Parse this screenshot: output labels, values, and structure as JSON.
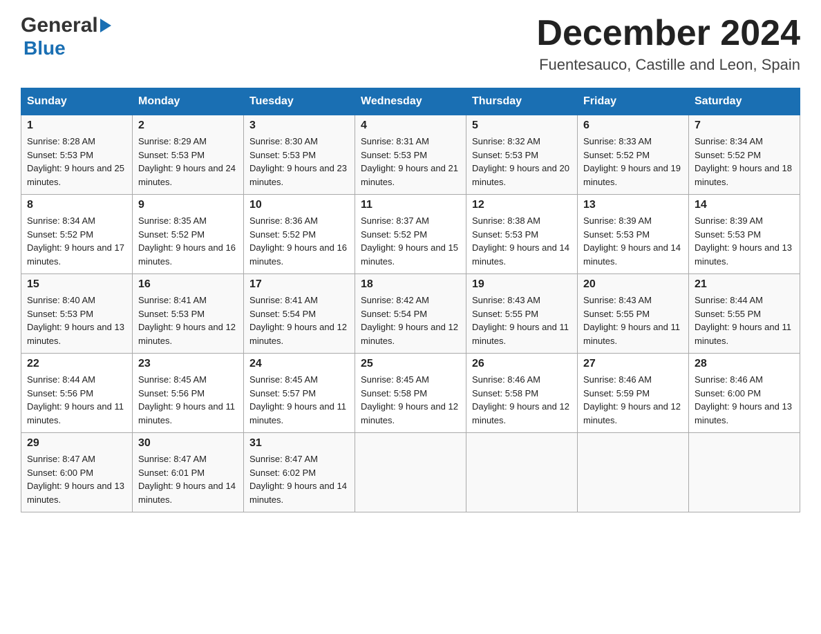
{
  "logo": {
    "general": "General",
    "blue": "Blue"
  },
  "title": {
    "month": "December 2024",
    "location": "Fuentesauco, Castille and Leon, Spain"
  },
  "headers": [
    "Sunday",
    "Monday",
    "Tuesday",
    "Wednesday",
    "Thursday",
    "Friday",
    "Saturday"
  ],
  "weeks": [
    [
      {
        "day": "1",
        "sunrise": "Sunrise: 8:28 AM",
        "sunset": "Sunset: 5:53 PM",
        "daylight": "Daylight: 9 hours and 25 minutes."
      },
      {
        "day": "2",
        "sunrise": "Sunrise: 8:29 AM",
        "sunset": "Sunset: 5:53 PM",
        "daylight": "Daylight: 9 hours and 24 minutes."
      },
      {
        "day": "3",
        "sunrise": "Sunrise: 8:30 AM",
        "sunset": "Sunset: 5:53 PM",
        "daylight": "Daylight: 9 hours and 23 minutes."
      },
      {
        "day": "4",
        "sunrise": "Sunrise: 8:31 AM",
        "sunset": "Sunset: 5:53 PM",
        "daylight": "Daylight: 9 hours and 21 minutes."
      },
      {
        "day": "5",
        "sunrise": "Sunrise: 8:32 AM",
        "sunset": "Sunset: 5:53 PM",
        "daylight": "Daylight: 9 hours and 20 minutes."
      },
      {
        "day": "6",
        "sunrise": "Sunrise: 8:33 AM",
        "sunset": "Sunset: 5:52 PM",
        "daylight": "Daylight: 9 hours and 19 minutes."
      },
      {
        "day": "7",
        "sunrise": "Sunrise: 8:34 AM",
        "sunset": "Sunset: 5:52 PM",
        "daylight": "Daylight: 9 hours and 18 minutes."
      }
    ],
    [
      {
        "day": "8",
        "sunrise": "Sunrise: 8:34 AM",
        "sunset": "Sunset: 5:52 PM",
        "daylight": "Daylight: 9 hours and 17 minutes."
      },
      {
        "day": "9",
        "sunrise": "Sunrise: 8:35 AM",
        "sunset": "Sunset: 5:52 PM",
        "daylight": "Daylight: 9 hours and 16 minutes."
      },
      {
        "day": "10",
        "sunrise": "Sunrise: 8:36 AM",
        "sunset": "Sunset: 5:52 PM",
        "daylight": "Daylight: 9 hours and 16 minutes."
      },
      {
        "day": "11",
        "sunrise": "Sunrise: 8:37 AM",
        "sunset": "Sunset: 5:52 PM",
        "daylight": "Daylight: 9 hours and 15 minutes."
      },
      {
        "day": "12",
        "sunrise": "Sunrise: 8:38 AM",
        "sunset": "Sunset: 5:53 PM",
        "daylight": "Daylight: 9 hours and 14 minutes."
      },
      {
        "day": "13",
        "sunrise": "Sunrise: 8:39 AM",
        "sunset": "Sunset: 5:53 PM",
        "daylight": "Daylight: 9 hours and 14 minutes."
      },
      {
        "day": "14",
        "sunrise": "Sunrise: 8:39 AM",
        "sunset": "Sunset: 5:53 PM",
        "daylight": "Daylight: 9 hours and 13 minutes."
      }
    ],
    [
      {
        "day": "15",
        "sunrise": "Sunrise: 8:40 AM",
        "sunset": "Sunset: 5:53 PM",
        "daylight": "Daylight: 9 hours and 13 minutes."
      },
      {
        "day": "16",
        "sunrise": "Sunrise: 8:41 AM",
        "sunset": "Sunset: 5:53 PM",
        "daylight": "Daylight: 9 hours and 12 minutes."
      },
      {
        "day": "17",
        "sunrise": "Sunrise: 8:41 AM",
        "sunset": "Sunset: 5:54 PM",
        "daylight": "Daylight: 9 hours and 12 minutes."
      },
      {
        "day": "18",
        "sunrise": "Sunrise: 8:42 AM",
        "sunset": "Sunset: 5:54 PM",
        "daylight": "Daylight: 9 hours and 12 minutes."
      },
      {
        "day": "19",
        "sunrise": "Sunrise: 8:43 AM",
        "sunset": "Sunset: 5:55 PM",
        "daylight": "Daylight: 9 hours and 11 minutes."
      },
      {
        "day": "20",
        "sunrise": "Sunrise: 8:43 AM",
        "sunset": "Sunset: 5:55 PM",
        "daylight": "Daylight: 9 hours and 11 minutes."
      },
      {
        "day": "21",
        "sunrise": "Sunrise: 8:44 AM",
        "sunset": "Sunset: 5:55 PM",
        "daylight": "Daylight: 9 hours and 11 minutes."
      }
    ],
    [
      {
        "day": "22",
        "sunrise": "Sunrise: 8:44 AM",
        "sunset": "Sunset: 5:56 PM",
        "daylight": "Daylight: 9 hours and 11 minutes."
      },
      {
        "day": "23",
        "sunrise": "Sunrise: 8:45 AM",
        "sunset": "Sunset: 5:56 PM",
        "daylight": "Daylight: 9 hours and 11 minutes."
      },
      {
        "day": "24",
        "sunrise": "Sunrise: 8:45 AM",
        "sunset": "Sunset: 5:57 PM",
        "daylight": "Daylight: 9 hours and 11 minutes."
      },
      {
        "day": "25",
        "sunrise": "Sunrise: 8:45 AM",
        "sunset": "Sunset: 5:58 PM",
        "daylight": "Daylight: 9 hours and 12 minutes."
      },
      {
        "day": "26",
        "sunrise": "Sunrise: 8:46 AM",
        "sunset": "Sunset: 5:58 PM",
        "daylight": "Daylight: 9 hours and 12 minutes."
      },
      {
        "day": "27",
        "sunrise": "Sunrise: 8:46 AM",
        "sunset": "Sunset: 5:59 PM",
        "daylight": "Daylight: 9 hours and 12 minutes."
      },
      {
        "day": "28",
        "sunrise": "Sunrise: 8:46 AM",
        "sunset": "Sunset: 6:00 PM",
        "daylight": "Daylight: 9 hours and 13 minutes."
      }
    ],
    [
      {
        "day": "29",
        "sunrise": "Sunrise: 8:47 AM",
        "sunset": "Sunset: 6:00 PM",
        "daylight": "Daylight: 9 hours and 13 minutes."
      },
      {
        "day": "30",
        "sunrise": "Sunrise: 8:47 AM",
        "sunset": "Sunset: 6:01 PM",
        "daylight": "Daylight: 9 hours and 14 minutes."
      },
      {
        "day": "31",
        "sunrise": "Sunrise: 8:47 AM",
        "sunset": "Sunset: 6:02 PM",
        "daylight": "Daylight: 9 hours and 14 minutes."
      },
      null,
      null,
      null,
      null
    ]
  ]
}
